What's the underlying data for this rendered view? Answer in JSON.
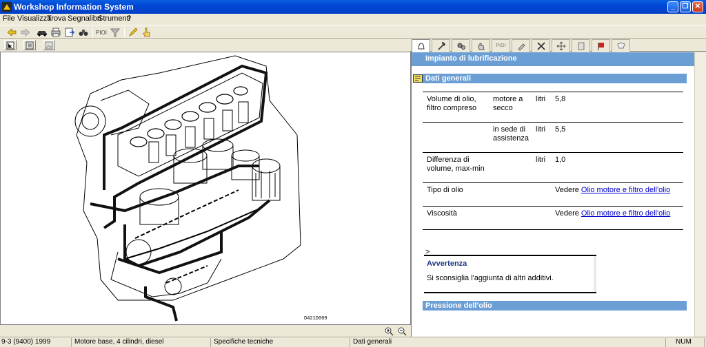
{
  "window": {
    "title": "Workshop Information System"
  },
  "menu": [
    "File",
    "Visualizza",
    "Trova",
    "Segnalibri",
    "Strumenti",
    "?"
  ],
  "toolbar": {
    "icons": [
      "back-arrow-icon",
      "forward-arrow-icon",
      "car-icon",
      "print-icon",
      "export-icon",
      "binoculars-icon",
      "pioi-icon",
      "funnel-icon",
      "pencil-icon",
      "hand-pointer-icon"
    ],
    "pioi_label": "PIOI"
  },
  "tabs": {
    "icons": [
      "bell-icon",
      "wrench-icon",
      "gears-icon",
      "hand-icon",
      "pioi-icon",
      "screwdriver-icon",
      "tools-icon",
      "move-icon",
      "document-icon",
      "warning-flag-icon",
      "clipboard-icon"
    ],
    "pioi_label": "PIOI"
  },
  "diagram": {
    "code": "D421D009"
  },
  "content": {
    "header": "Impianto di lubrificazione",
    "section1": "Dati generali",
    "rows": [
      {
        "c1": "Volume di olio, filtro compreso",
        "c2": "motore a secco",
        "c3": "litri",
        "c4": "5,8",
        "c4_link": ""
      },
      {
        "c1": "",
        "c2": "in sede di assistenza",
        "c3": "litri",
        "c4": "5,5",
        "c4_link": ""
      },
      {
        "c1": "Differenza di volume, max-min",
        "c2": "",
        "c3": "litri",
        "c4": "1,0",
        "c4_link": ""
      },
      {
        "c1": "Tipo di olio",
        "c2": "",
        "c3": "",
        "c4": "Vedere ",
        "c4_link": "Olio motore e filtro dell'olio"
      },
      {
        "c1": "Viscosità",
        "c2": "",
        "c3": "",
        "c4": "Vedere ",
        "c4_link": "Olio motore e filtro dell'olio"
      }
    ],
    "gt_marker": ">",
    "warning": {
      "title": "Avvertenza",
      "text": "Si sconsiglia l'aggiunta di altri additivi."
    },
    "section2": "Pressione dell'olio"
  },
  "status": {
    "model": "9-3 (9400) 1999",
    "engine": "Motore base, 4 cilindri, diesel",
    "category": "Specifiche tecniche",
    "page": "Dati generali",
    "num": "NUM"
  },
  "colors": {
    "title_blue": "#0046d5",
    "section_blue": "#6a9ed4",
    "link": "#0000cc"
  }
}
